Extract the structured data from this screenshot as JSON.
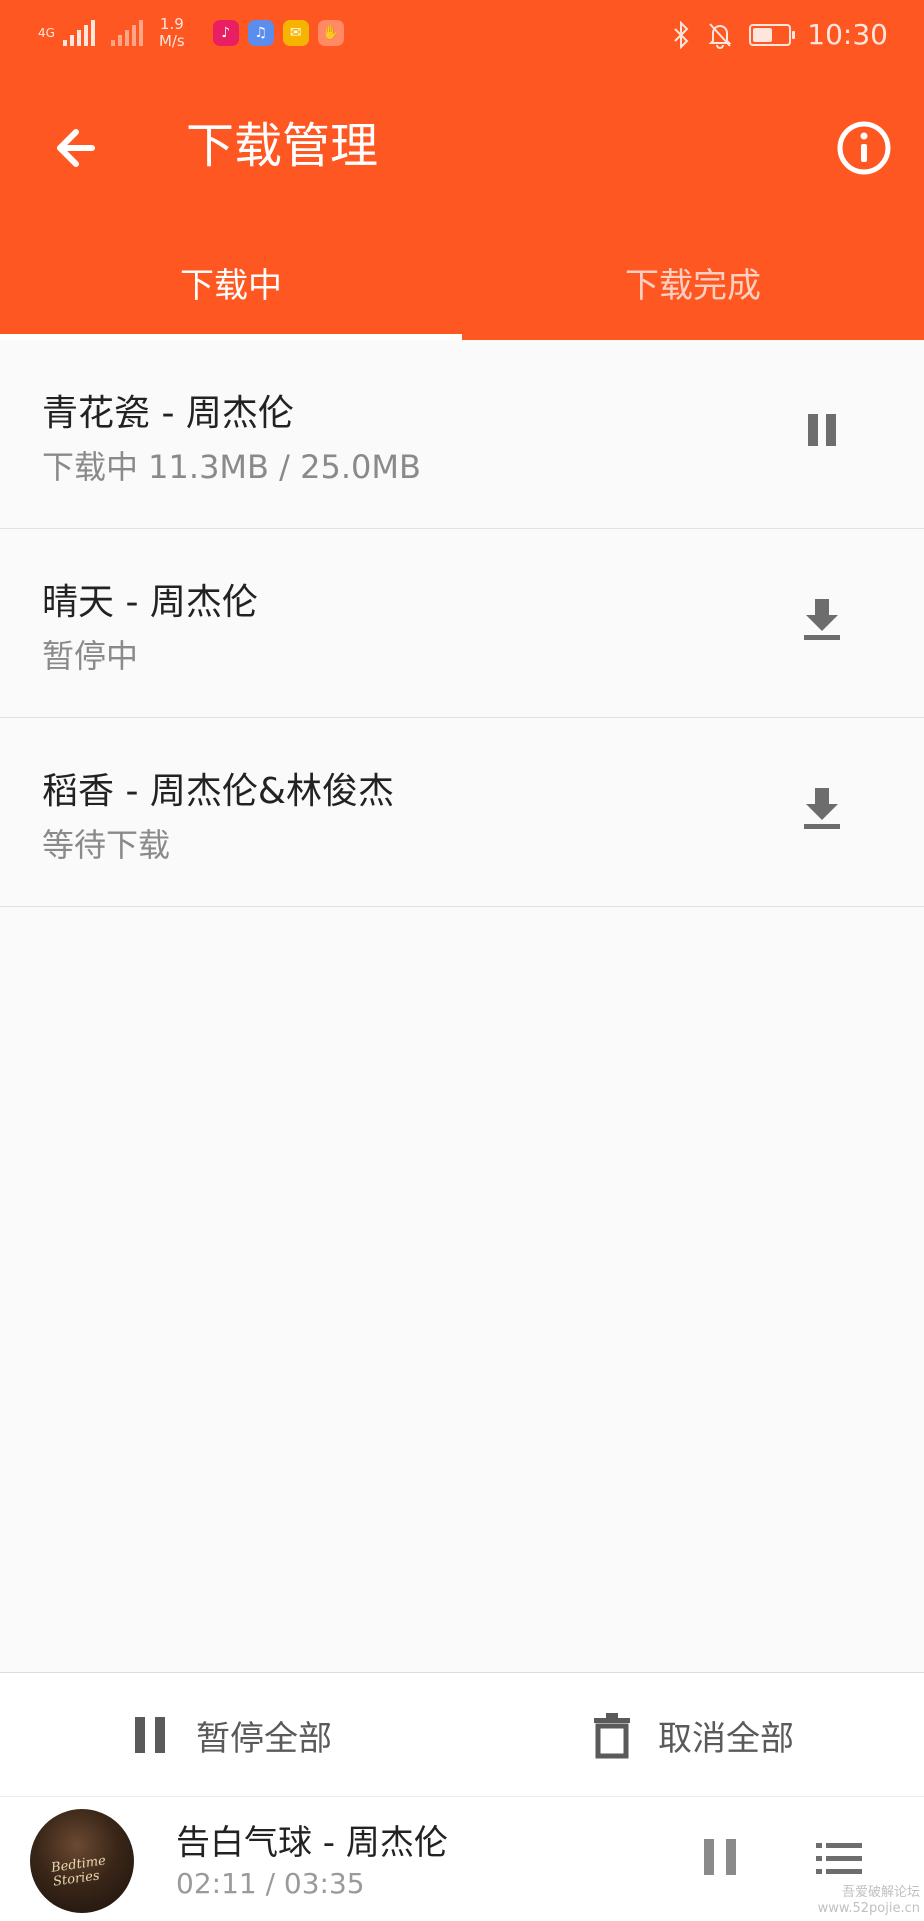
{
  "status_bar": {
    "network_type": "4G",
    "speed_value": "1.9",
    "speed_unit": "M/s",
    "time": "10:30",
    "battery_level": 0.55,
    "app_icons": [
      {
        "name": "music-app-icon",
        "color": "#e91e63"
      },
      {
        "name": "music-note-app-icon",
        "color": "#5b8def"
      },
      {
        "name": "mail-app-icon",
        "color": "#f4b400"
      },
      {
        "name": "hand-app-icon",
        "color": "#ff8a65"
      }
    ]
  },
  "toolbar": {
    "title": "下载管理",
    "back_icon": "arrow-back-icon",
    "info_icon": "info-icon",
    "color": "#ff5722"
  },
  "tabs": [
    {
      "label": "下载中",
      "active": true
    },
    {
      "label": "下载完成",
      "active": false
    }
  ],
  "downloads": [
    {
      "title": "青花瓷 - 周杰伦",
      "status": "下载中 11.3MB / 25.0MB",
      "action_icon": "pause-icon"
    },
    {
      "title": "晴天 - 周杰伦",
      "status": "暂停中",
      "action_icon": "download-icon"
    },
    {
      "title": "稻香 - 周杰伦&林俊杰",
      "status": "等待下载",
      "action_icon": "download-icon"
    }
  ],
  "actions": {
    "pause_all": "暂停全部",
    "cancel_all": "取消全部"
  },
  "player": {
    "song": "告白气球 - 周杰伦",
    "time": "02:11 / 03:35",
    "album_text": "Bedtime Stories"
  },
  "watermark": {
    "line1": "吾爱破解论坛",
    "line2": "www.52pojie.cn"
  }
}
